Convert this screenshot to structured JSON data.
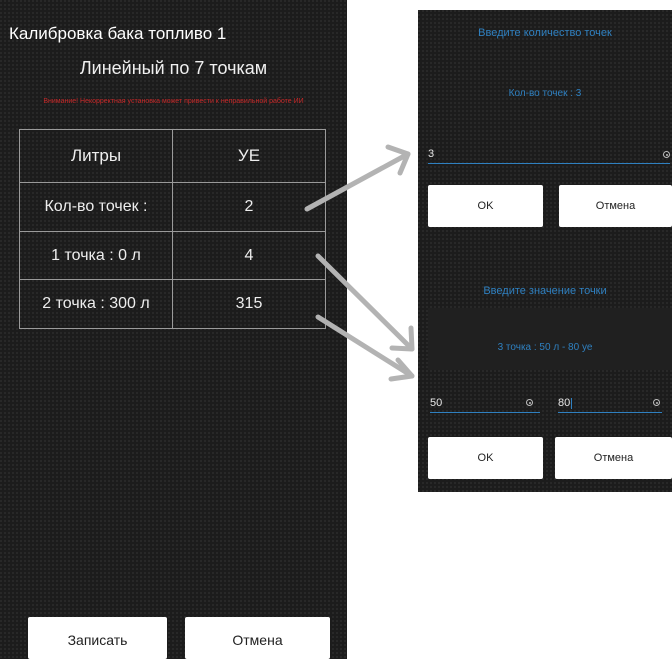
{
  "main": {
    "title": "Калибровка бака топливо 1",
    "subtitle": "Линейный по 7 точкам",
    "warning": "Внимание! Некорректная установка может привести к неправильной работе ИИ",
    "table": {
      "headers": [
        "Литры",
        "УЕ"
      ],
      "rows": [
        [
          "Кол-во точек :",
          "2"
        ],
        [
          "1 точка : 0 л",
          "4"
        ],
        [
          "2 точка : 300 л",
          "315"
        ]
      ]
    },
    "buttons": {
      "save": "Записать",
      "cancel": "Отмена"
    }
  },
  "dialog_points_count": {
    "title": "Введите количество точек",
    "message": "Кол-во точек : 3",
    "input_value": "3",
    "buttons": {
      "ok": "OK",
      "cancel": "Отмена"
    }
  },
  "dialog_point_value": {
    "title": "Введите значение точки",
    "message": "3 точка : 50 л - 80 уе",
    "input_liters": "50",
    "input_units": "80",
    "buttons": {
      "ok": "OK",
      "cancel": "Отмена"
    }
  },
  "colors": {
    "background": "#1c1c1c",
    "accent": "#2f80c0",
    "warning": "#c62828",
    "arrow": "#b3b3b3"
  },
  "icons": [
    "clear-icon",
    "arrow-icon"
  ]
}
